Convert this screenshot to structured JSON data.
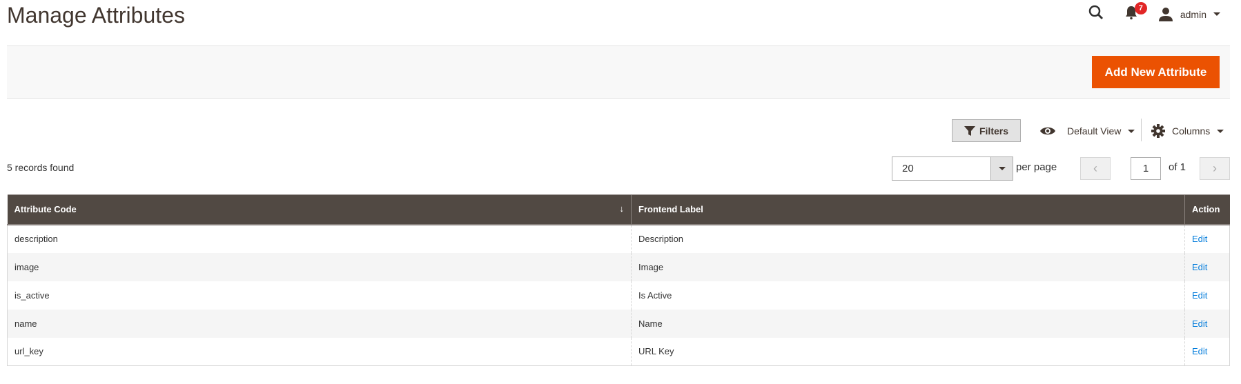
{
  "header": {
    "title": "Manage Attributes",
    "notification_count": "7",
    "user": "admin",
    "icons": [
      "search-icon",
      "bell-icon",
      "user-icon"
    ]
  },
  "actions": {
    "add_new": "Add New Attribute",
    "accent": "#eb5202"
  },
  "toolbar": {
    "filters": "Filters",
    "view": "Default View",
    "columns": "Columns"
  },
  "grid": {
    "records": "5 records found",
    "per_page_value": "20",
    "per_page_label": "per page",
    "page": "1",
    "of_pages": "of 1",
    "columns": [
      "Attribute Code",
      "Frontend Label",
      "Action"
    ],
    "rows": [
      {
        "code": "description",
        "label": "Description",
        "action": "Edit"
      },
      {
        "code": "image",
        "label": "Image",
        "action": "Edit"
      },
      {
        "code": "is_active",
        "label": "Is Active",
        "action": "Edit"
      },
      {
        "code": "name",
        "label": "Name",
        "action": "Edit"
      },
      {
        "code": "url_key",
        "label": "URL Key",
        "action": "Edit"
      }
    ]
  }
}
